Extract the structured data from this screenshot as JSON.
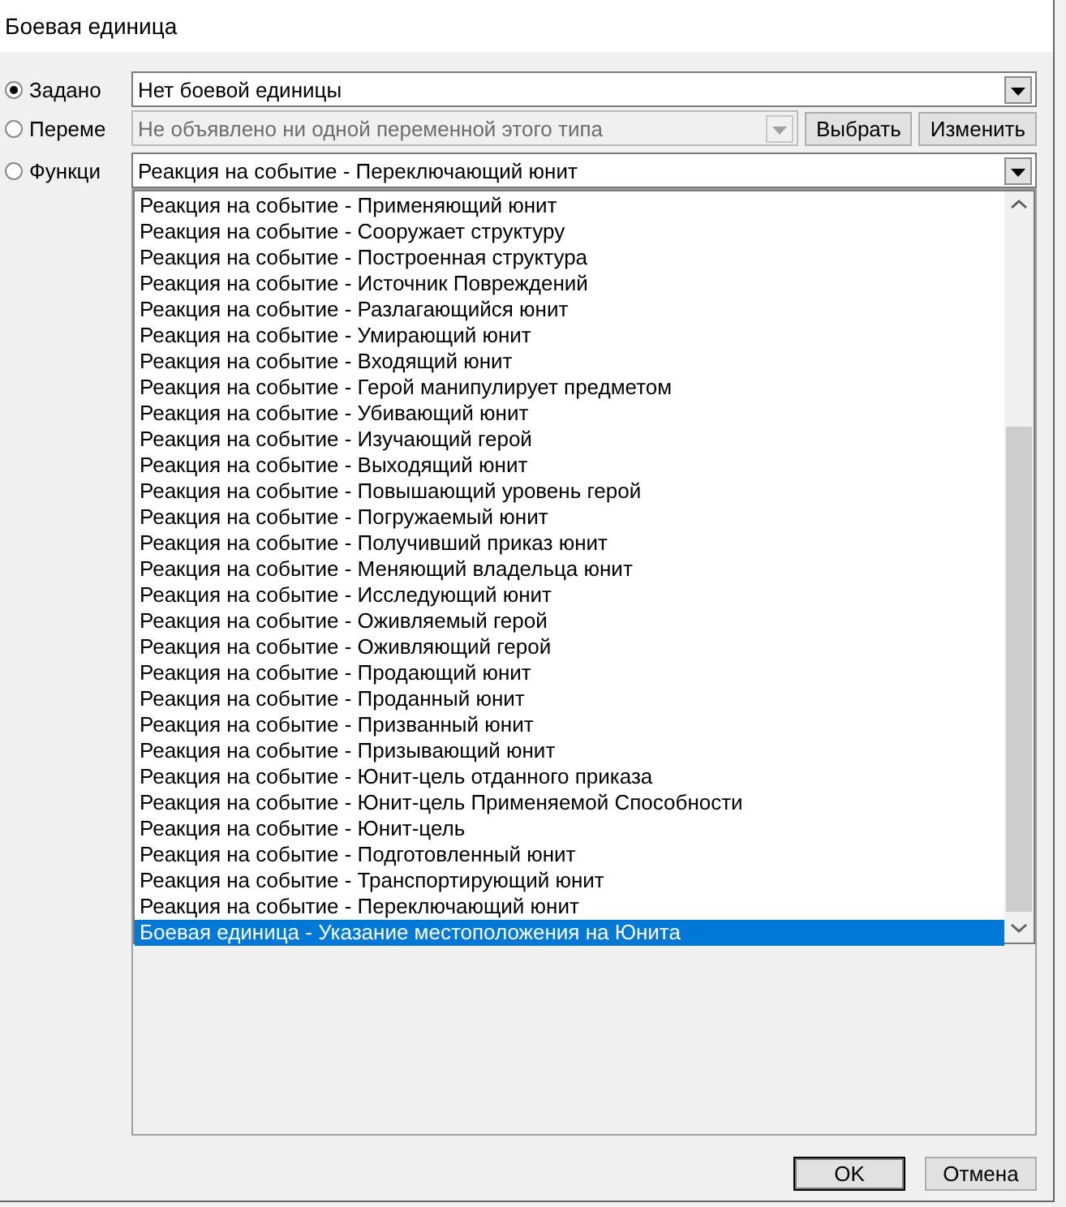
{
  "window": {
    "title": "Боевая единица"
  },
  "rows": [
    {
      "label": "Задано",
      "selected": true,
      "value": "Нет боевой единицы",
      "disabled": false,
      "buttons": []
    },
    {
      "label": "Переме",
      "selected": false,
      "value": "Не объявлено ни одной переменной этого типа",
      "disabled": true,
      "buttons": [
        "Выбрать",
        "Изменить"
      ]
    },
    {
      "label": "Функци",
      "selected": false,
      "value": "Реакция на событие - Переключающий юнит",
      "disabled": false,
      "buttons": []
    }
  ],
  "dropdown_list": {
    "items": [
      {
        "text": "Реакция на событие - Применяющий юнит",
        "selected": false
      },
      {
        "text": "Реакция на событие - Сооружает структуру",
        "selected": false
      },
      {
        "text": "Реакция на событие - Построенная структура",
        "selected": false
      },
      {
        "text": "Реакция на событие - Источник Повреждений",
        "selected": false
      },
      {
        "text": "Реакция на событие - Разлагающийся юнит",
        "selected": false
      },
      {
        "text": "Реакция на событие - Умирающий юнит",
        "selected": false
      },
      {
        "text": "Реакция на событие - Входящий юнит",
        "selected": false
      },
      {
        "text": "Реакция на событие - Герой манипулирует предметом",
        "selected": false
      },
      {
        "text": "Реакция на событие - Убивающий юнит",
        "selected": false
      },
      {
        "text": "Реакция на событие - Изучающий герой",
        "selected": false
      },
      {
        "text": "Реакция на событие - Выходящий юнит",
        "selected": false
      },
      {
        "text": "Реакция на событие - Повышающий уровень герой",
        "selected": false
      },
      {
        "text": "Реакция на событие - Погружаемый юнит",
        "selected": false
      },
      {
        "text": "Реакция на событие - Получивший приказ юнит",
        "selected": false
      },
      {
        "text": "Реакция на событие - Меняющий владельца юнит",
        "selected": false
      },
      {
        "text": "Реакция на событие - Исследующий юнит",
        "selected": false
      },
      {
        "text": "Реакция на событие - Оживляемый герой",
        "selected": false
      },
      {
        "text": "Реакция на событие - Оживляющий герой",
        "selected": false
      },
      {
        "text": "Реакция на событие - Продающий юнит",
        "selected": false
      },
      {
        "text": "Реакция на событие - Проданный юнит",
        "selected": false
      },
      {
        "text": "Реакция на событие - Призванный юнит",
        "selected": false
      },
      {
        "text": "Реакция на событие - Призывающий юнит",
        "selected": false
      },
      {
        "text": "Реакция на событие - Юнит-цель отданного приказа",
        "selected": false
      },
      {
        "text": "Реакция на событие - Юнит-цель Применяемой Способности",
        "selected": false
      },
      {
        "text": "Реакция на событие - Юнит-цель",
        "selected": false
      },
      {
        "text": "Реакция на событие - Подготовленный юнит",
        "selected": false
      },
      {
        "text": "Реакция на событие - Транспортирующий юнит",
        "selected": false
      },
      {
        "text": "Реакция на событие - Переключающий юнит",
        "selected": false
      },
      {
        "text": "Боевая единица - Указание местоположения на Юнита",
        "selected": true
      }
    ]
  },
  "buttons": [
    "OK",
    "Отмена"
  ]
}
